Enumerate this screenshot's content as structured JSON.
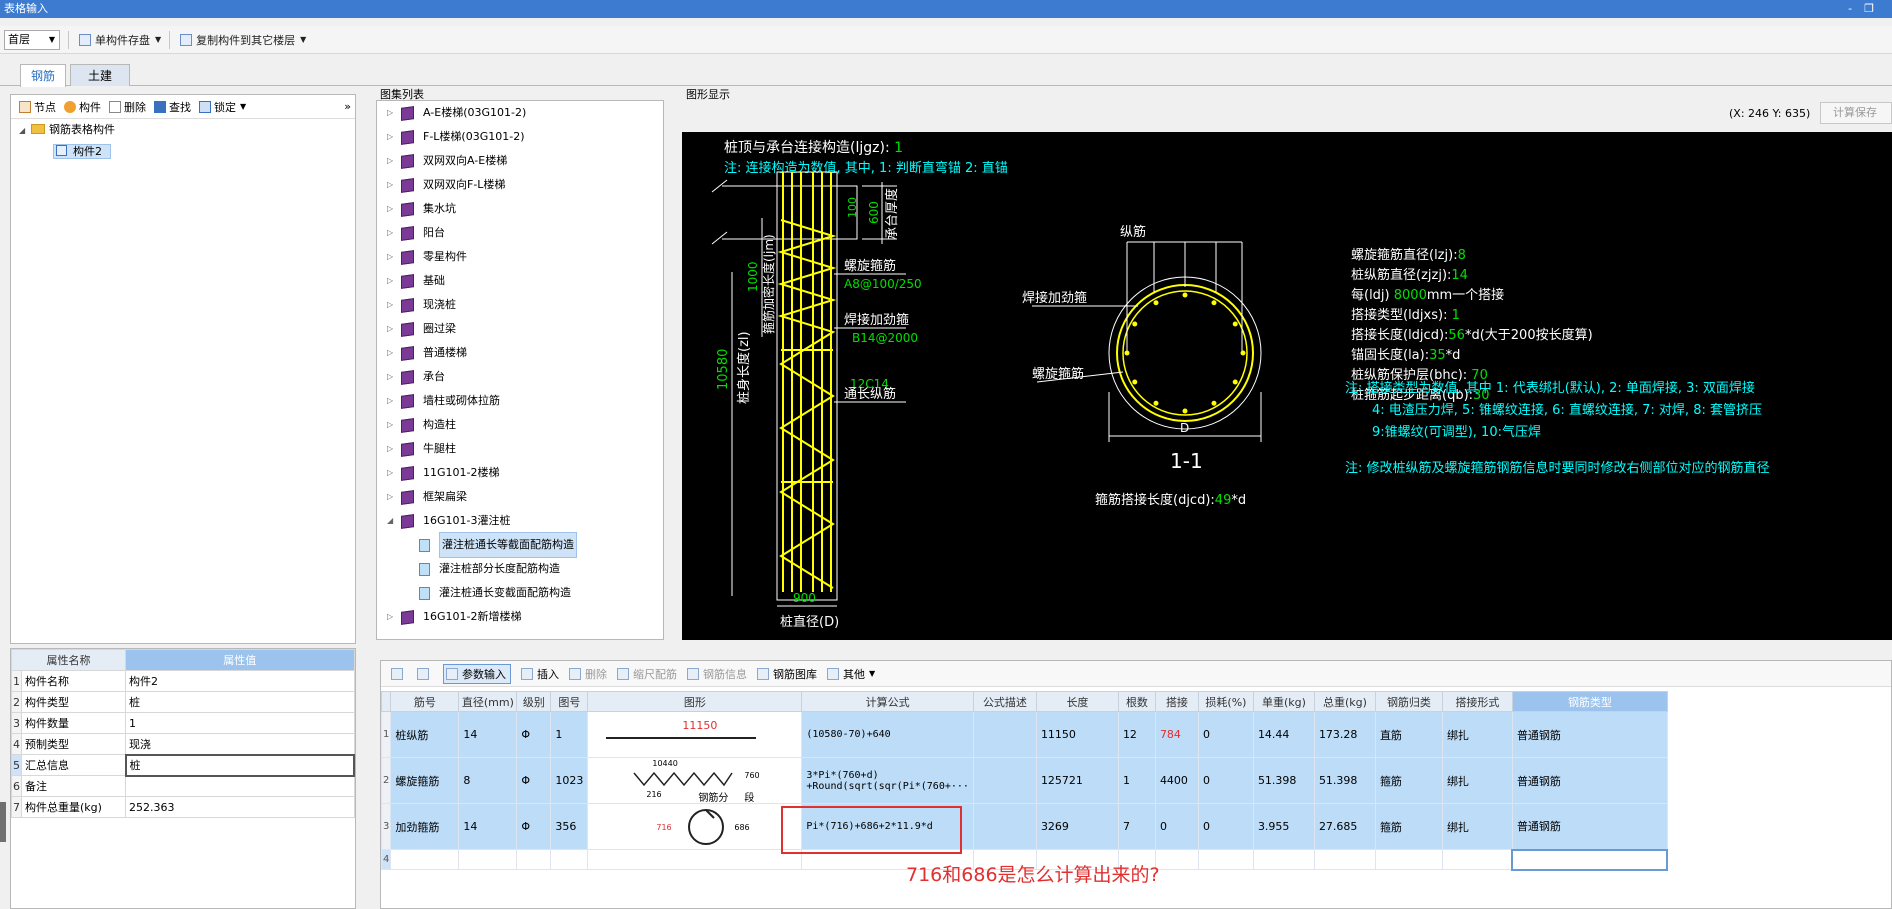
{
  "window": {
    "title": "表格输入",
    "controls": [
      "-",
      "❐"
    ]
  },
  "toolbar": {
    "floor": "首层",
    "save_single": "单构件存盘",
    "copy_to_floor": "复制构件到其它楼层"
  },
  "tabs": [
    {
      "label": "钢筋"
    },
    {
      "label": "土建"
    }
  ],
  "left_toolbar": {
    "node": "节点",
    "component": "构件",
    "delete": "删除",
    "find": "查找",
    "lock": "锁定",
    "more": "»"
  },
  "tree": {
    "root": "钢筋表格构件",
    "child": "构件2"
  },
  "properties": {
    "header_name": "属性名称",
    "header_value": "属性值",
    "rows": [
      {
        "n": "1",
        "name": "构件名称",
        "value": "构件2"
      },
      {
        "n": "2",
        "name": "构件类型",
        "value": "桩"
      },
      {
        "n": "3",
        "name": "构件数量",
        "value": "1"
      },
      {
        "n": "4",
        "name": "预制类型",
        "value": "现浇"
      },
      {
        "n": "5",
        "name": "汇总信息",
        "value": "桩"
      },
      {
        "n": "6",
        "name": "备注",
        "value": ""
      },
      {
        "n": "7",
        "name": "构件总重量(kg)",
        "value": "252.363"
      }
    ]
  },
  "atlas": {
    "label": "图集列表",
    "items": [
      "A-E楼梯(03G101-2)",
      "F-L楼梯(03G101-2)",
      "双网双向A-E楼梯",
      "双网双向F-L楼梯",
      "集水坑",
      "阳台",
      "零星构件",
      "基础",
      "现浇桩",
      "圈过梁",
      "普通楼梯",
      "承台",
      "墙柱或砌体拉筋",
      "构造柱",
      "牛腿柱",
      "11G101-2楼梯",
      "框架扁梁",
      "16G101-3灌注桩"
    ],
    "children": [
      "灌注桩通长等截面配筋构造",
      "灌注桩部分长度配筋构造",
      "灌注桩通长变截面配筋构造"
    ],
    "last": "16G101-2新增楼梯"
  },
  "graph": {
    "label": "图形显示",
    "coord": "(X: 246 Y: 635)",
    "calc_save": "计算保存",
    "line1_label": "桩顶与承台连接构造(ljgz): ",
    "line1_value": "1",
    "line2": "注: 连接构造为数值, 其中, 1: 判断直弯锚     2: 直锚",
    "dim_600": "600",
    "cap_thickness": "承台厚度",
    "dim_100": "100",
    "dim_1000": "1000",
    "dense_len": "箍筋加密长度(ljm)",
    "dim_10580": "10580",
    "pile_len": "桩身长度(zl)",
    "spiral_label": "螺旋箍筋",
    "spiral_spec": "A8@100/250",
    "weld_label": "焊接加劲箍",
    "weld_spec": "B14@2000",
    "long_spec": "12C14",
    "long_label": "通长纵筋",
    "dim_900": "900",
    "pile_dia": "桩直径(D)",
    "sec_long": "纵筋",
    "sec_weld": "焊接加劲箍",
    "sec_spiral": "螺旋箍筋",
    "sec_D": "D",
    "sec_name": "1-1",
    "stir_lap_label": "箍筋搭接长度(djcd):",
    "stir_lap_value": "49",
    "stir_lap_unit": "*d",
    "params": [
      {
        "label": "螺旋箍筋直径(lzj):",
        "value": "8",
        "suffix": ""
      },
      {
        "label": "桩纵筋直径(zjzj):",
        "value": "14",
        "suffix": ""
      },
      {
        "label": "每(ldj) ",
        "value": "8000",
        "suffix": "mm一个搭接"
      },
      {
        "label": "搭接类型(ldjxs): ",
        "value": "1",
        "suffix": ""
      },
      {
        "label": "搭接长度(ldjcd):",
        "value": "56",
        "suffix": "*d(大于200按长度算)"
      },
      {
        "label": "锚固长度(la):",
        "value": "35",
        "suffix": "*d"
      },
      {
        "label": "桩纵筋保护层(bhc): ",
        "value": "70",
        "suffix": ""
      },
      {
        "label": "桩箍筋起步距离(qb):",
        "value": "30",
        "suffix": ""
      }
    ],
    "note1": "注: 搭接类型为数值, 其中 1: 代表绑扎(默认), 2: 单面焊接, 3: 双面焊接",
    "note2": "4: 电渣压力焊, 5: 锥螺纹连接, 6: 直螺纹连接, 7: 对焊, 8: 套管挤压",
    "note3": "9:锥螺纹(可调型), 10:气压焊",
    "note4": "注: 修改桩纵筋及螺旋箍筋钢筋信息时要同时修改右侧部位对应的钢筋直径"
  },
  "grid_toolbar": {
    "param_input": "参数输入",
    "insert": "插入",
    "delete": "删除",
    "scale": "缩尺配筋",
    "info": "钢筋信息",
    "library": "钢筋图库",
    "other": "其他"
  },
  "rebar_table": {
    "headers": [
      "筋号",
      "直径(mm)",
      "级别",
      "图号",
      "图形",
      "计算公式",
      "公式描述",
      "长度",
      "根数",
      "搭接",
      "损耗(%)",
      "单重(kg)",
      "总重(kg)",
      "钢筋归类",
      "搭接形式",
      "钢筋类型"
    ],
    "rows": [
      {
        "n": "1",
        "name": "桩纵筋",
        "dia": "14",
        "grade": "Φ",
        "fig": "1",
        "shape_val": "11150",
        "formula": "(10580-70)+640",
        "desc": "",
        "len": "11150",
        "count": "12",
        "lap": "784",
        "loss": "0",
        "unit_w": "14.44",
        "total_w": "173.28",
        "cat": "直筋",
        "lap_form": "绑扎",
        "type": "普通钢筋"
      },
      {
        "n": "2",
        "name": "螺旋箍筋",
        "dia": "8",
        "grade": "Φ",
        "fig": "1023",
        "shape_val": "10440",
        "shape_val2": "760",
        "shape_val3": "216",
        "shape_seg": "钢筋分",
        "shape_seg2": "段",
        "formula": "3*Pi*(760+d)",
        "formula2": "+Round(sqrt(sqr(Pi*(760+···",
        "desc": "",
        "len": "125721",
        "count": "1",
        "lap": "4400",
        "loss": "0",
        "unit_w": "51.398",
        "total_w": "51.398",
        "cat": "箍筋",
        "lap_form": "绑扎",
        "type": "普通钢筋"
      },
      {
        "n": "3",
        "name": "加劲箍筋",
        "dia": "14",
        "grade": "Φ",
        "fig": "356",
        "shape_val": "716",
        "shape_val2": "686",
        "formula": "Pi*(716)+686+2*11.9*d",
        "desc": "",
        "len": "3269",
        "count": "7",
        "lap": "0",
        "loss": "0",
        "unit_w": "3.955",
        "total_w": "27.685",
        "cat": "箍筋",
        "lap_form": "绑扎",
        "type": "普通钢筋"
      }
    ],
    "empty_row_num": "4"
  },
  "annotation": {
    "question": "716和686是怎么计算出来的?"
  },
  "colors": {
    "yellow": "#ffff00",
    "green": "#00e000",
    "cyan": "#00ffff",
    "white": "#ffffff",
    "red": "#ff3030"
  }
}
